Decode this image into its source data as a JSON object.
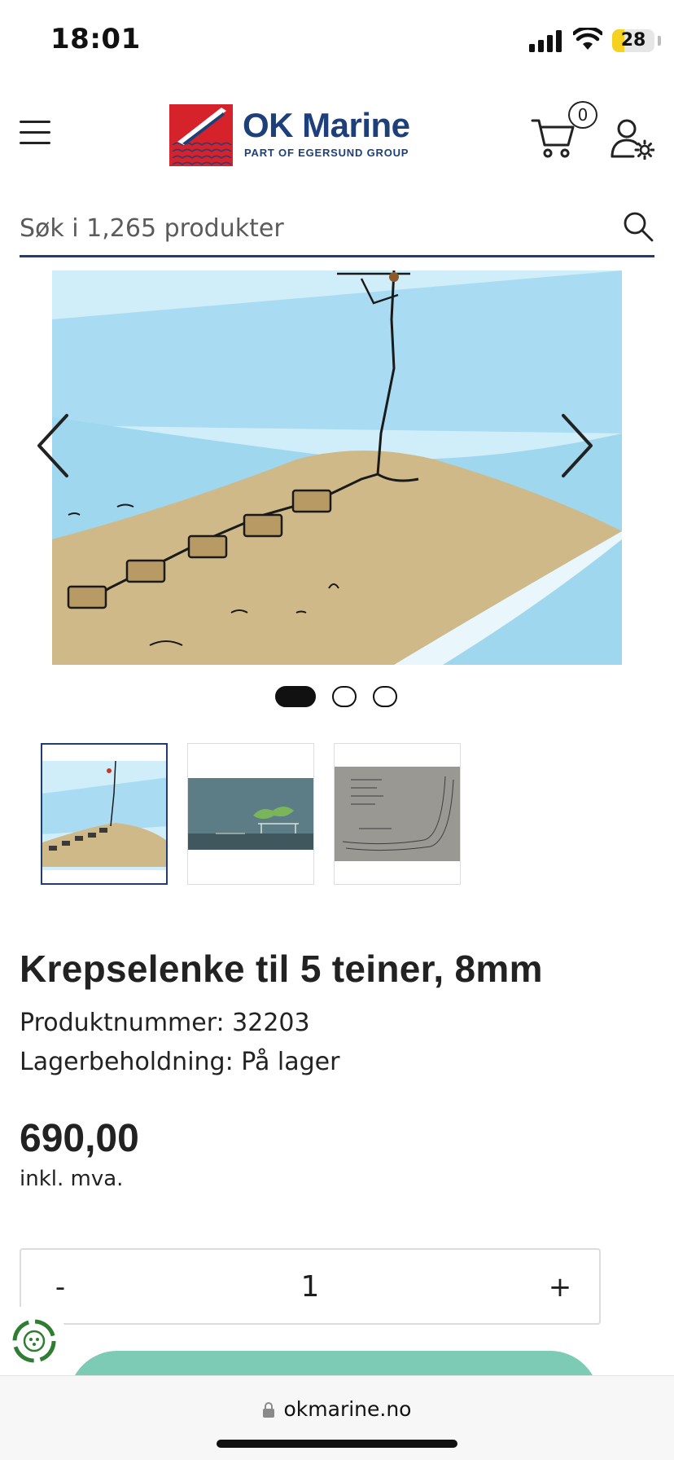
{
  "status_bar": {
    "time": "18:01",
    "battery_level": "28",
    "battery_fraction": 0.28,
    "icons": [
      "cellular-signal-icon",
      "wifi-icon",
      "battery-icon"
    ]
  },
  "header": {
    "logo": {
      "name": "OK Marine",
      "tagline": "PART OF EGERSUND GROUP"
    },
    "cart_count": "0",
    "icons": [
      "hamburger-menu-icon",
      "shopping-cart-icon",
      "account-settings-icon"
    ]
  },
  "search": {
    "placeholder": "Søk i 1,265 produkter",
    "value": "",
    "icon": "search-icon"
  },
  "carousel": {
    "active_index": 0,
    "slide_count": 3,
    "icons": [
      "chevron-left-icon",
      "chevron-right-icon"
    ]
  },
  "thumbnails": {
    "count": 3,
    "active_index": 0
  },
  "product": {
    "title": "Krepselenke til 5 teiner, 8mm",
    "product_number": "Produktnummer: 32203",
    "stock": "Lagerbeholdning: På lager",
    "price": "690,00",
    "vat_note": "inkl. mva."
  },
  "quantity": {
    "minus_label": "-",
    "value": "1",
    "plus_label": "+"
  },
  "browser": {
    "url": "okmarine.no"
  },
  "colors": {
    "brand_navy": "#1d3f7a",
    "brand_red": "#d6232b",
    "accent_teal": "#7ecbb5",
    "battery_yellow": "#f4d21f"
  }
}
